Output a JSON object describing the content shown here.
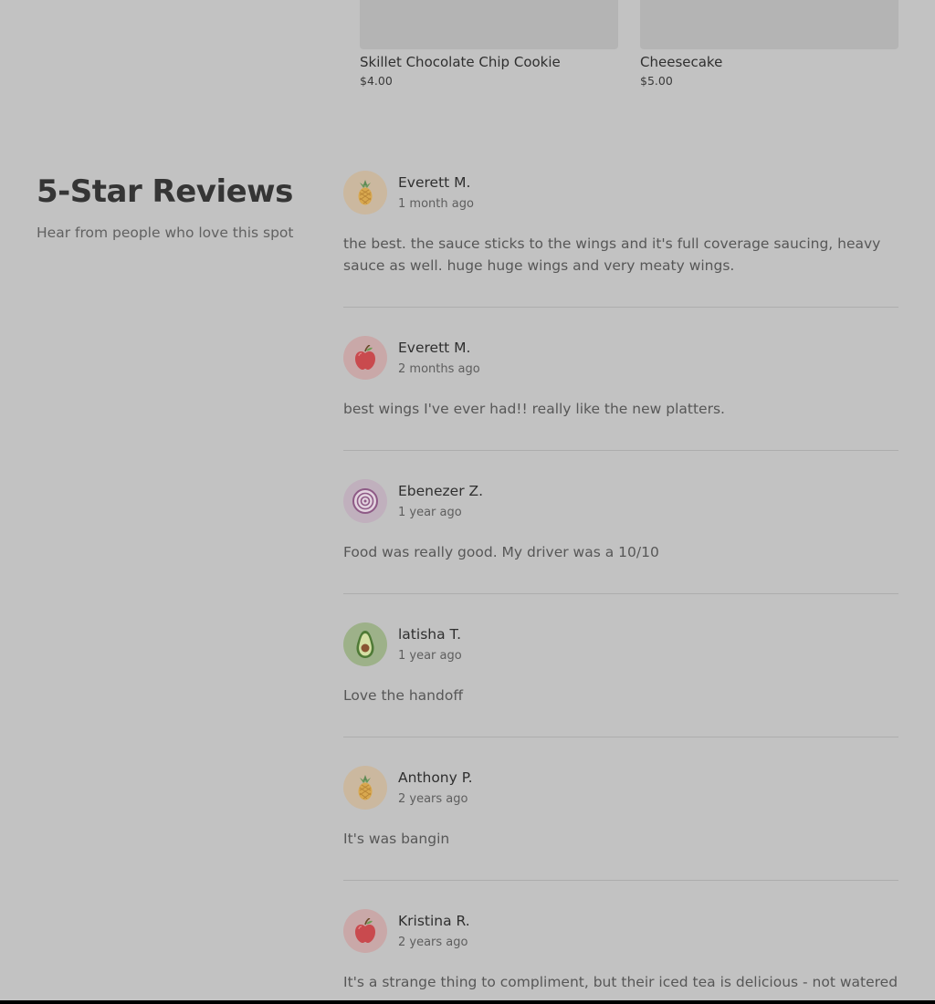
{
  "products": [
    {
      "name": "Skillet Chocolate Chip Cookie",
      "price": "$4.00"
    },
    {
      "name": "Cheesecake",
      "price": "$5.00"
    }
  ],
  "reviews_section": {
    "title": "5-Star Reviews",
    "subtitle": "Hear from people who love this spot"
  },
  "reviews": [
    {
      "name": "Everett M.",
      "time": "1 month ago",
      "avatar_icon": "pineapple-icon",
      "text": "the best. the sauce sticks to the wings and it's full coverage saucing, heavy sauce as well. huge huge wings and very meaty wings."
    },
    {
      "name": "Everett M.",
      "time": "2 months ago",
      "avatar_icon": "apple-icon",
      "text": "best wings I've ever had!! really like the new platters."
    },
    {
      "name": "Ebenezer Z.",
      "time": "1 year ago",
      "avatar_icon": "onion-icon",
      "text": "Food was really good. My driver was a 10/10"
    },
    {
      "name": "latisha T.",
      "time": "1 year ago",
      "avatar_icon": "avocado-icon",
      "text": "Love the handoff"
    },
    {
      "name": "Anthony P.",
      "time": "2 years ago",
      "avatar_icon": "pineapple-icon",
      "text": "It's was bangin"
    },
    {
      "name": "Kristina R.",
      "time": "2 years ago",
      "avatar_icon": "apple-icon",
      "text": "It's a strange thing to compliment, but their iced tea is delicious - not watered"
    }
  ]
}
